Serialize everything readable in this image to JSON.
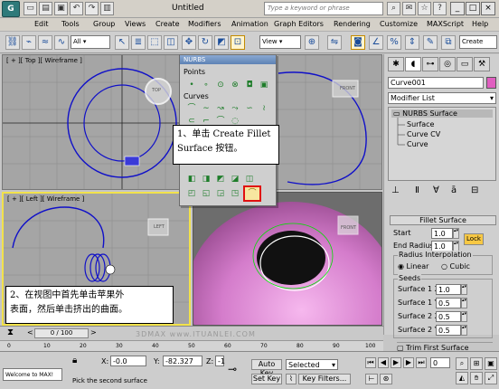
{
  "title_bar": {
    "app_icon": "3ds-max-logo-icon",
    "document_title": "Untitled",
    "help_search_placeholder": "Type a keyword or phrase"
  },
  "menu": [
    "Edit",
    "Tools",
    "Group",
    "Views",
    "Create",
    "Modifiers",
    "Animation",
    "Graph Editors",
    "Rendering",
    "Customize",
    "MAXScript",
    "Help"
  ],
  "toolbar": {
    "selection_filter": "All",
    "reference_coord": "View",
    "named_selection": "Create"
  },
  "viewports": {
    "top_label": "[ + ][ Top ][ Wireframe ]",
    "front_label": "FRONT",
    "left_label": "[ + ][ Left ][ Wireframe ]",
    "left_cube_label": "LEFT",
    "persp_cube_label": "FRONT",
    "top_cube_label": "TOP"
  },
  "nurbs_toolbox": {
    "title": "NURBS",
    "sections": [
      "Points",
      "Curves"
    ]
  },
  "callouts": {
    "step1_line1": "1、单击 Create Fillet",
    "step1_line2": "Surface 按钮。",
    "step2_line1": "2、在视图中首先单击苹果外",
    "step2_line2": "表面，然后单击挤出的曲面。"
  },
  "command_panel": {
    "object_name": "Curve001",
    "object_color": "#e05fc0",
    "modifier_list": "Modifier List",
    "stack": [
      "NURBS Surface",
      "Surface",
      "Curve CV",
      "Curve"
    ],
    "fillet_rollout_title": "Fillet Surface",
    "start_label": "Start",
    "start_value": "1.0",
    "lock_label": "Lock",
    "end_radius_label": "End Radius:",
    "end_radius_value": "1.0",
    "radius_interp_label": "Radius Interpolation",
    "linear_label": "Linear",
    "cubic_label": "Cubic",
    "seeds_label": "Seeds",
    "seeds": [
      {
        "label": "Surface 1 X:",
        "value": "1.0"
      },
      {
        "label": "Surface 1 Y:",
        "value": "0.5"
      },
      {
        "label": "Surface 2 X:",
        "value": "0.5"
      },
      {
        "label": "Surface 2 Y:",
        "value": "0.5"
      }
    ],
    "trim_first_label": "Trim First Surface"
  },
  "timeline": {
    "frame_range": "0 / 100",
    "ticks": [
      "0",
      "10",
      "20",
      "30",
      "40",
      "50",
      "60",
      "70",
      "80",
      "90",
      "100"
    ]
  },
  "status": {
    "maxscript_listener": "Welcome to MAX!",
    "prompt": "Pick the second surface",
    "x_label": "X:",
    "x_value": "-0.0",
    "y_label": "Y:",
    "y_value": "-82.327",
    "z_label": "Z:",
    "z_value": "-1",
    "auto_key": "Auto Key",
    "set_key": "Set Key",
    "key_mode": "Selected",
    "key_filters": "Key Filters...",
    "current_frame": "0"
  },
  "watermark": "3DMAX www.ITUANLEI.COM"
}
